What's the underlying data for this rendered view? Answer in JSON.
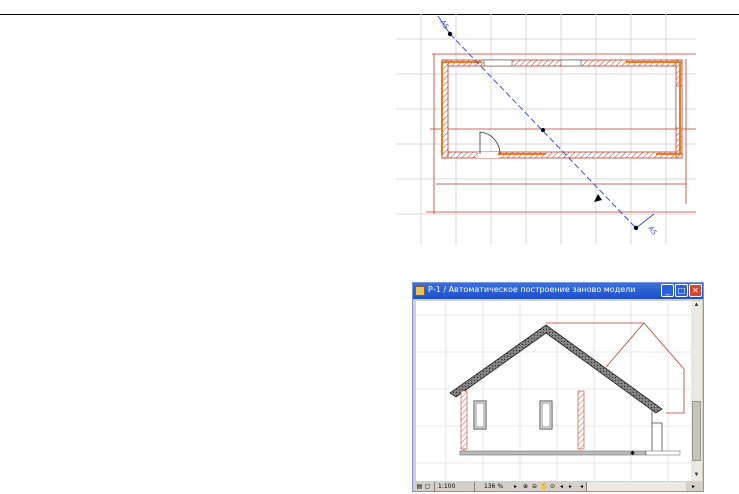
{
  "plan": {
    "section_label_top": "А5",
    "section_label_bottom": "А5"
  },
  "elevation_window": {
    "title": "Р-1 / Автоматическое построение заново модели",
    "min_btn": "_",
    "max_btn": "□",
    "close_btn": "✕",
    "status": {
      "scale": "1:100",
      "zoom": "136 %"
    },
    "toolbar_icons": [
      "zoom-in-icon",
      "zoom-out-icon",
      "pan-icon",
      "zoom-fit-icon",
      "zoom-prev-icon",
      "zoom-next-icon"
    ]
  },
  "colors": {
    "wall_hatch": "#c0392b",
    "wall_highlight": "#f07a1a",
    "section_line": "#3b50d0",
    "grid": "#d9d9d9",
    "title_bar": "#245edb"
  }
}
